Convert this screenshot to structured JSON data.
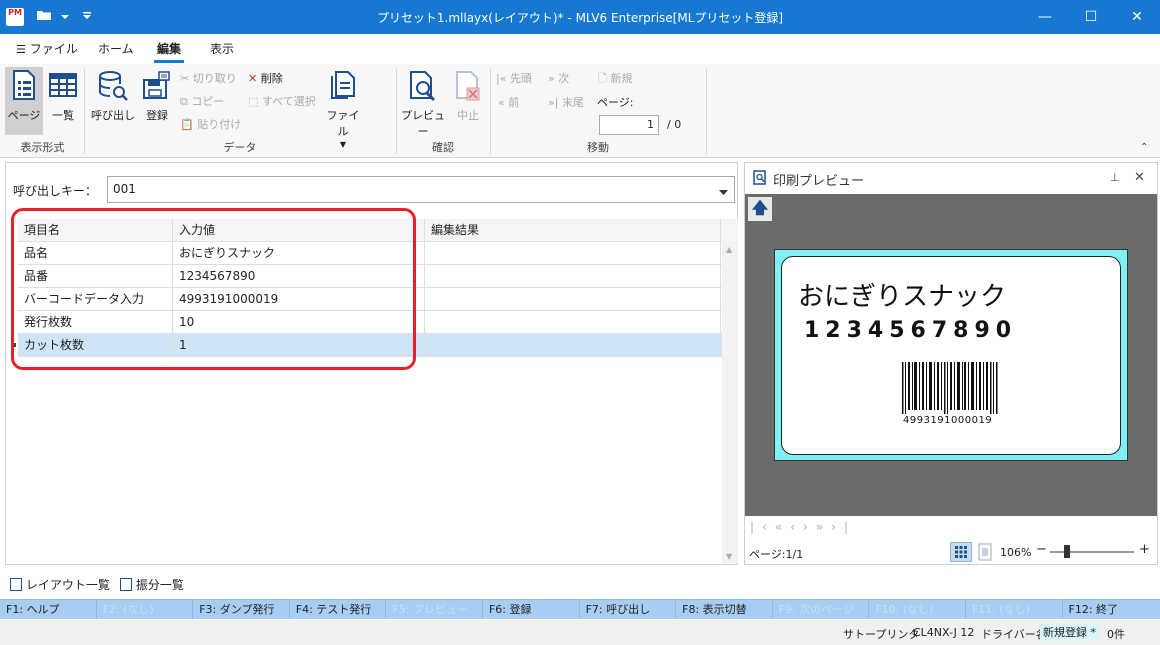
{
  "window": {
    "title": "プリセット1.mllayx(レイアウト)* - MLV6 Enterprise[MLプリセット登録]",
    "app_icon_text": "PM",
    "minimize": "—",
    "maximize": "☐",
    "close": "✕"
  },
  "menu": {
    "file": "ファイル",
    "home": "ホーム",
    "edit": "編集",
    "view": "表示"
  },
  "ribbon": {
    "groups": {
      "display": "表示形式",
      "data": "データ",
      "confirm": "確認",
      "move": "移動"
    },
    "page": "ページ",
    "list": "一覧",
    "call": "呼び出し",
    "register": "登録",
    "cut": "切り取り",
    "copy": "コピー",
    "paste": "貼り付け",
    "delete": "削除",
    "select_all": "すべて選択",
    "file": "ファイル",
    "preview": "プレビュー",
    "stop": "中止",
    "first": "先頭",
    "next": "次",
    "prev": "前",
    "last": "末尾",
    "new": "新規",
    "page_label": "ページ:",
    "page_value": "1",
    "page_total": "/ 0"
  },
  "form": {
    "call_key_label": "呼び出しキー：",
    "call_key_value": "001"
  },
  "grid": {
    "headers": [
      "項目名",
      "入力値",
      "編集結果"
    ],
    "rows": [
      {
        "name": "品名",
        "value": "おにぎりスナック"
      },
      {
        "name": "品番",
        "value": "1234567890"
      },
      {
        "name": "バーコードデータ入力",
        "value": "4993191000019"
      },
      {
        "name": "発行枚数",
        "value": "10"
      },
      {
        "name": "カット枚数",
        "value": "1"
      }
    ]
  },
  "preview": {
    "title": "印刷プレビュー",
    "label": {
      "name": "おにぎりスナック",
      "code": "1234567890",
      "barcode_text": "4993191000019"
    },
    "page_info": "ページ:1/1",
    "zoom": "106%"
  },
  "bottom_tabs": {
    "layout_list": "レイアウト一覧",
    "dist_list": "振分一覧"
  },
  "fkeys": [
    {
      "label": "F1: ヘルプ",
      "enabled": true
    },
    {
      "label": "F2: (なし)",
      "enabled": false
    },
    {
      "label": "F3: ダンプ発行",
      "enabled": true
    },
    {
      "label": "F4: テスト発行",
      "enabled": true
    },
    {
      "label": "F5: プレビュー",
      "enabled": false
    },
    {
      "label": "F6: 登録",
      "enabled": true
    },
    {
      "label": "F7: 呼び出し",
      "enabled": true
    },
    {
      "label": "F8: 表示切替",
      "enabled": true
    },
    {
      "label": "F9: 次のページ",
      "enabled": false
    },
    {
      "label": "F10: (なし)",
      "enabled": false
    },
    {
      "label": "F11: (なし)",
      "enabled": false
    },
    {
      "label": "F12: 終了",
      "enabled": true
    }
  ],
  "status": {
    "printer_label": "サトープリンタ",
    "printer_model": "CL4NX-J 12",
    "driver_label": "ドライバー名",
    "mode": "新規登録 *",
    "count": "0件"
  },
  "colors": {
    "accent": "#1778d2",
    "label_bg": "#7ff0f4",
    "fkey_bg": "#a8cdf2",
    "highlight": "#e8202a"
  }
}
